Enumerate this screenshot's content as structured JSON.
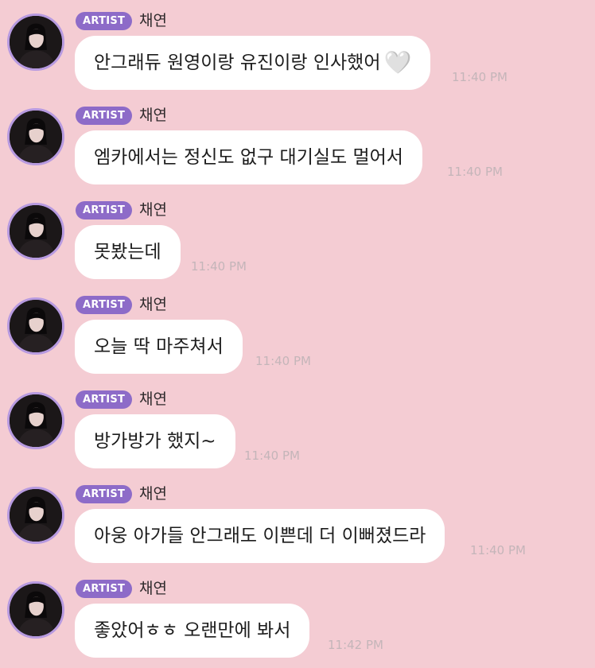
{
  "chat": {
    "messages": [
      {
        "badge": "ARTIST",
        "sender": "채연",
        "text": "안그래듀 원영이랑 유진이랑 인사했어",
        "emoji": "🤍",
        "time": "11:40 PM"
      },
      {
        "badge": "ARTIST",
        "sender": "채연",
        "text": "엠카에서는 정신도 없구 대기실도 멀어서",
        "emoji": "",
        "time": "11:40 PM"
      },
      {
        "badge": "ARTIST",
        "sender": "채연",
        "text": "못봤는데",
        "emoji": "",
        "time": "11:40 PM"
      },
      {
        "badge": "ARTIST",
        "sender": "채연",
        "text": "오늘 딱 마주쳐서",
        "emoji": "",
        "time": "11:40 PM"
      },
      {
        "badge": "ARTIST",
        "sender": "채연",
        "text": "방가방가 했지~",
        "emoji": "",
        "time": "11:40 PM"
      },
      {
        "badge": "ARTIST",
        "sender": "채연",
        "text": "아웅 아가들 안그래도 이쁜데 더 이뻐졌드라",
        "emoji": "",
        "time": "11:40 PM"
      },
      {
        "badge": "ARTIST",
        "sender": "채연",
        "text": "좋았어ㅎㅎ 오랜만에 봐서",
        "emoji": "",
        "time": "11:42 PM"
      }
    ]
  }
}
